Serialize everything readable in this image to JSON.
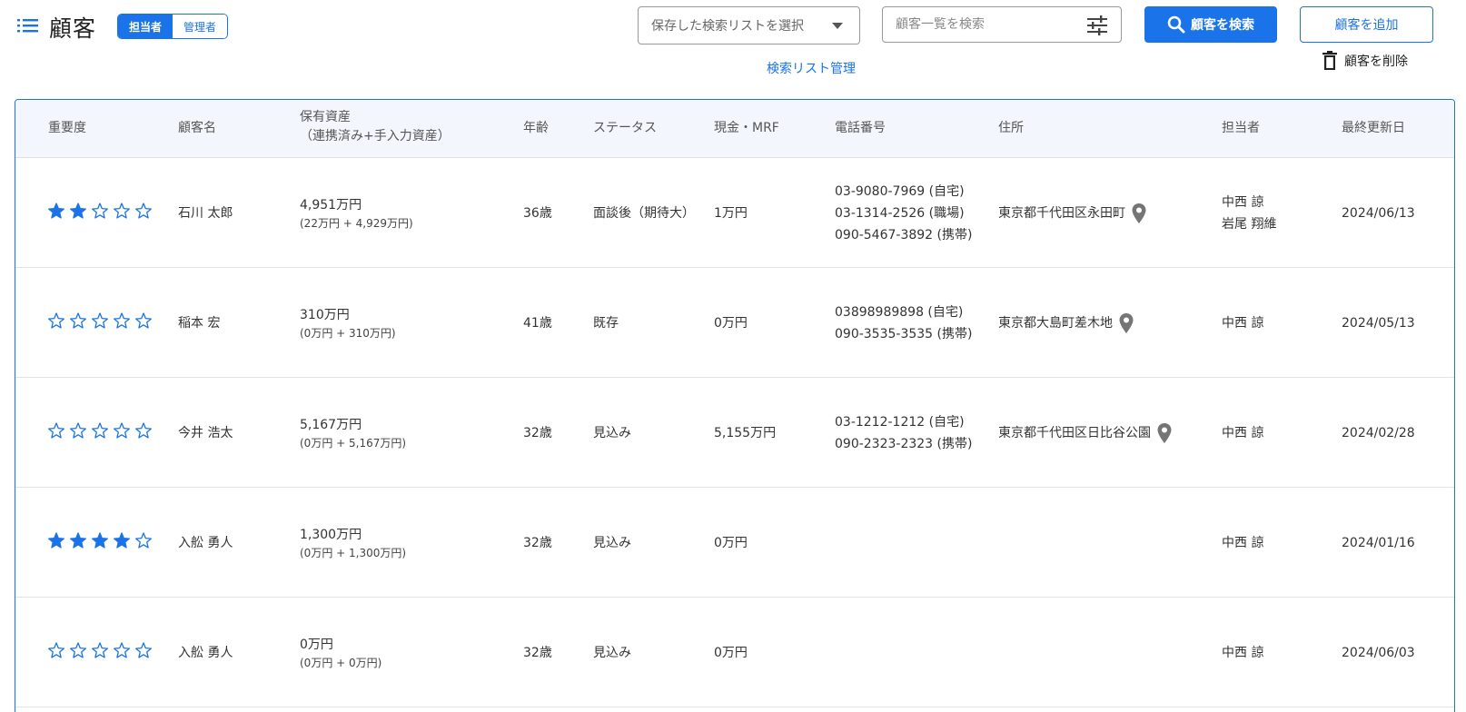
{
  "header": {
    "title": "顧客",
    "roles": [
      "担当者",
      "管理者"
    ],
    "active_role": 0,
    "saved_search_placeholder": "保存した検索リストを選択",
    "manage_link": "検索リスト管理",
    "search_placeholder": "顧客一覧を検索",
    "search_button": "顧客を検索",
    "add_button": "顧客を追加",
    "delete_button": "顧客を削除"
  },
  "colors": {
    "accent": "#1a73e8",
    "pin": "#757575"
  },
  "table": {
    "columns": {
      "importance": "重要度",
      "name": "顧客名",
      "assets": "保有資産",
      "assets_sub": "（連携済み+手入力資産）",
      "age": "年齢",
      "status": "ステータス",
      "cash": "現金・MRF",
      "phone": "電話番号",
      "address": "住所",
      "owner": "担当者",
      "updated": "最終更新日"
    },
    "rows": [
      {
        "rating": 2,
        "name": "石川 太郎",
        "assets": "4,951万円",
        "assets_detail": "(22万円 + 4,929万円)",
        "age": "36歳",
        "status": "面談後（期待大）",
        "cash": "1万円",
        "phones": [
          "03-9080-7969 (自宅)",
          "03-1314-2526 (職場)",
          "090-5467-3892 (携帯)"
        ],
        "address": "東京都千代田区永田町",
        "owners": [
          "中西 諒",
          "岩尾 翔維"
        ],
        "updated": "2024/06/13"
      },
      {
        "rating": 0,
        "name": "稲本 宏",
        "assets": "310万円",
        "assets_detail": "(0万円 + 310万円)",
        "age": "41歳",
        "status": "既存",
        "cash": "0万円",
        "phones": [
          "03898989898 (自宅)",
          "090-3535-3535 (携帯)"
        ],
        "address": "東京都大島町差木地",
        "owners": [
          "中西 諒"
        ],
        "updated": "2024/05/13"
      },
      {
        "rating": 0,
        "name": "今井 浩太",
        "assets": "5,167万円",
        "assets_detail": "(0万円 + 5,167万円)",
        "age": "32歳",
        "status": "見込み",
        "cash": "5,155万円",
        "phones": [
          "03-1212-1212 (自宅)",
          "090-2323-2323 (携帯)"
        ],
        "address": "東京都千代田区日比谷公園",
        "owners": [
          "中西 諒"
        ],
        "updated": "2024/02/28"
      },
      {
        "rating": 4,
        "name": "入舩 勇人",
        "assets": "1,300万円",
        "assets_detail": "(0万円 + 1,300万円)",
        "age": "32歳",
        "status": "見込み",
        "cash": "0万円",
        "phones": [],
        "address": "",
        "owners": [
          "中西 諒"
        ],
        "updated": "2024/01/16"
      },
      {
        "rating": 0,
        "name": "入舩 勇人",
        "assets": "0万円",
        "assets_detail": "(0万円 + 0万円)",
        "age": "32歳",
        "status": "見込み",
        "cash": "0万円",
        "phones": [],
        "address": "",
        "owners": [
          "中西 諒"
        ],
        "updated": "2024/06/03"
      }
    ]
  }
}
